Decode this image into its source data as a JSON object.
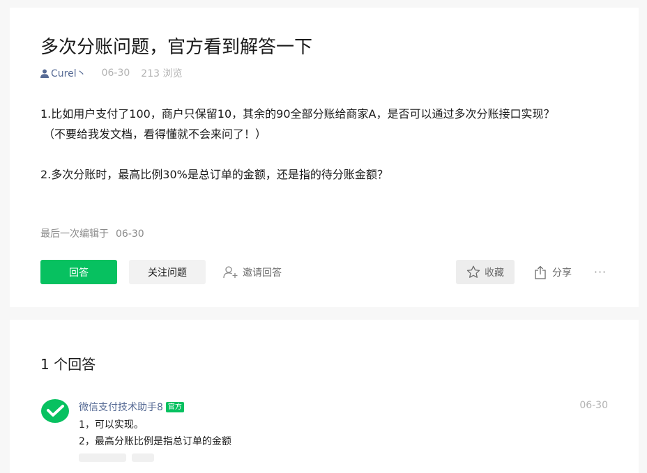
{
  "question": {
    "title": "多次分账问题，官方看到解答一下",
    "author": "Curel丶",
    "date": "06-30",
    "views": "213 浏览",
    "body": [
      "1.比如用户支付了100，商户只保留10，其余的90全部分账给商家A，是否可以通过多次分账接口实现？",
      "（不要给我发文档，看得懂就不会来问了！）",
      "2.多次分账时，最高比例30%是总订单的金额，还是指的待分账金额？"
    ],
    "edited_label": "最后一次编辑于",
    "edited_date": "06-30"
  },
  "actions": {
    "answer": "回答",
    "follow": "关注问题",
    "invite": "邀请回答",
    "collect": "收藏",
    "share": "分享",
    "more": "···"
  },
  "answers": {
    "count_label": "1 个回答",
    "items": [
      {
        "author": "微信支付技术助手8",
        "badge": "官方",
        "date": "06-30",
        "lines": [
          "1，可以实现。",
          "2，最高分账比例是指总订单的金额"
        ]
      }
    ]
  },
  "colors": {
    "accent": "#07c160",
    "link": "#576b95",
    "muted": "#b2b2b2"
  },
  "icons": {
    "author": "person-icon",
    "invite": "add-user-icon",
    "collect": "star-icon",
    "share": "share-icon",
    "avatar": "wechat-pay-logo"
  }
}
